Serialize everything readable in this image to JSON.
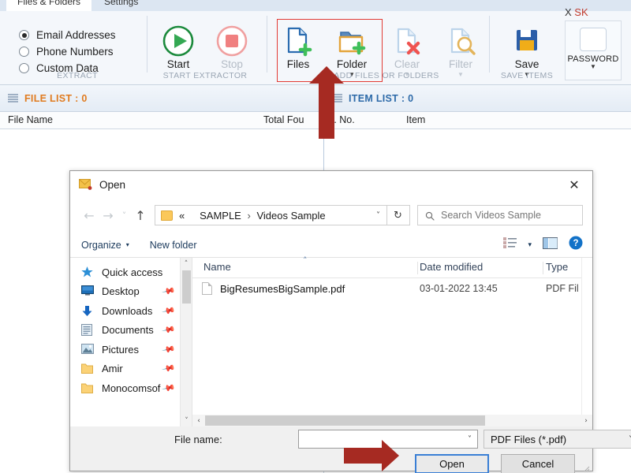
{
  "app": {
    "tabs": [
      {
        "label": "Files & Folders",
        "active": true
      },
      {
        "label": "Settings",
        "active": false
      }
    ],
    "corner_text": "X",
    "corner_text_red": "SK",
    "extract_group": {
      "label": "EXTRACT",
      "options": [
        {
          "label": "Email Addresses",
          "selected": true
        },
        {
          "label": "Phone Numbers",
          "selected": false
        },
        {
          "label": "Custom Data",
          "selected": false
        }
      ]
    },
    "start_group": {
      "label": "START EXTRACTOR",
      "buttons": [
        {
          "label": "Start",
          "icon": "play-icon",
          "enabled": true
        },
        {
          "label": "Stop",
          "icon": "stop-icon",
          "enabled": false
        }
      ]
    },
    "add_group": {
      "label": "ADD FILES OR FOLDERS",
      "buttons": [
        {
          "label": "Files",
          "icon": "add-file-icon",
          "enabled": true,
          "caret": false
        },
        {
          "label": "Folder",
          "icon": "add-folder-icon",
          "enabled": true,
          "caret": true
        },
        {
          "label": "Clear",
          "icon": "clear-file-icon",
          "enabled": false,
          "caret": true
        },
        {
          "label": "Filter",
          "icon": "filter-icon",
          "enabled": false,
          "caret": true
        }
      ]
    },
    "save_group": {
      "label": "SAVE ITEMS",
      "buttons": [
        {
          "label": "Save",
          "icon": "floppy-save-icon",
          "enabled": true,
          "caret": true
        }
      ]
    },
    "password_button": {
      "label": "PASSWORD",
      "caret": true
    }
  },
  "file_list_pane": {
    "header": "FILE LIST : 0",
    "header_color": "#e07b1f",
    "columns": [
      "File Name",
      "Total Fou"
    ]
  },
  "item_list_pane": {
    "header": "ITEM LIST : 0",
    "header_color": "#2d6aa8",
    "columns": [
      "S. No.",
      "Item"
    ]
  },
  "dialog": {
    "title": "Open",
    "close_label": "✕",
    "nav": {
      "back": "←",
      "forward": "→",
      "recent": "˅",
      "up": "↑",
      "breadcrumb_prefix": "«",
      "breadcrumb_parts": [
        "SAMPLE",
        "Videos Sample"
      ],
      "breadcrumb_sep": "›",
      "breadcrumb_dropdown": "˅",
      "refresh": "↻",
      "search_placeholder": "Search Videos Sample"
    },
    "toolbar": {
      "organize": "Organize",
      "organize_caret": "▾",
      "new_folder": "New folder",
      "view_caret": "▾",
      "help": "?"
    },
    "nav_pane": {
      "items": [
        {
          "label": "Quick access",
          "icon": "star-icon",
          "pinned": false
        },
        {
          "label": "Desktop",
          "icon": "desktop-icon",
          "pinned": true
        },
        {
          "label": "Downloads",
          "icon": "download-arrow-icon",
          "pinned": true
        },
        {
          "label": "Documents",
          "icon": "documents-icon",
          "pinned": true
        },
        {
          "label": "Pictures",
          "icon": "pictures-icon",
          "pinned": true
        },
        {
          "label": "Amir",
          "icon": "folder-icon",
          "pinned": true
        },
        {
          "label": "Monocomsof",
          "icon": "folder-icon",
          "pinned": true
        }
      ],
      "scroll_up": "˄",
      "scroll_down": "˅"
    },
    "files": {
      "columns": [
        {
          "label": "Name",
          "sorted": true
        },
        {
          "label": "Date modified",
          "sorted": false
        },
        {
          "label": "Type",
          "sorted": false
        }
      ],
      "sort_mark": "˄",
      "rows": [
        {
          "name": "BigResumesBigSample.pdf",
          "date_modified": "03-01-2022 13:45",
          "type": "PDF Fil",
          "icon": "pdf-file-icon"
        }
      ],
      "hscroll_left": "‹",
      "hscroll_right": "›"
    },
    "footer": {
      "file_name_label": "File name:",
      "file_name_value": "",
      "file_name_placeholder": "",
      "file_name_caret": "˅",
      "file_type_value": "PDF Files (*.pdf)",
      "file_type_caret": "˅",
      "open_button": "Open",
      "cancel_button": "Cancel"
    }
  },
  "annotations": {
    "highlight_color": "#e23b34",
    "arrow_color": "#a62a22",
    "guide_color": "#b9c9de"
  }
}
